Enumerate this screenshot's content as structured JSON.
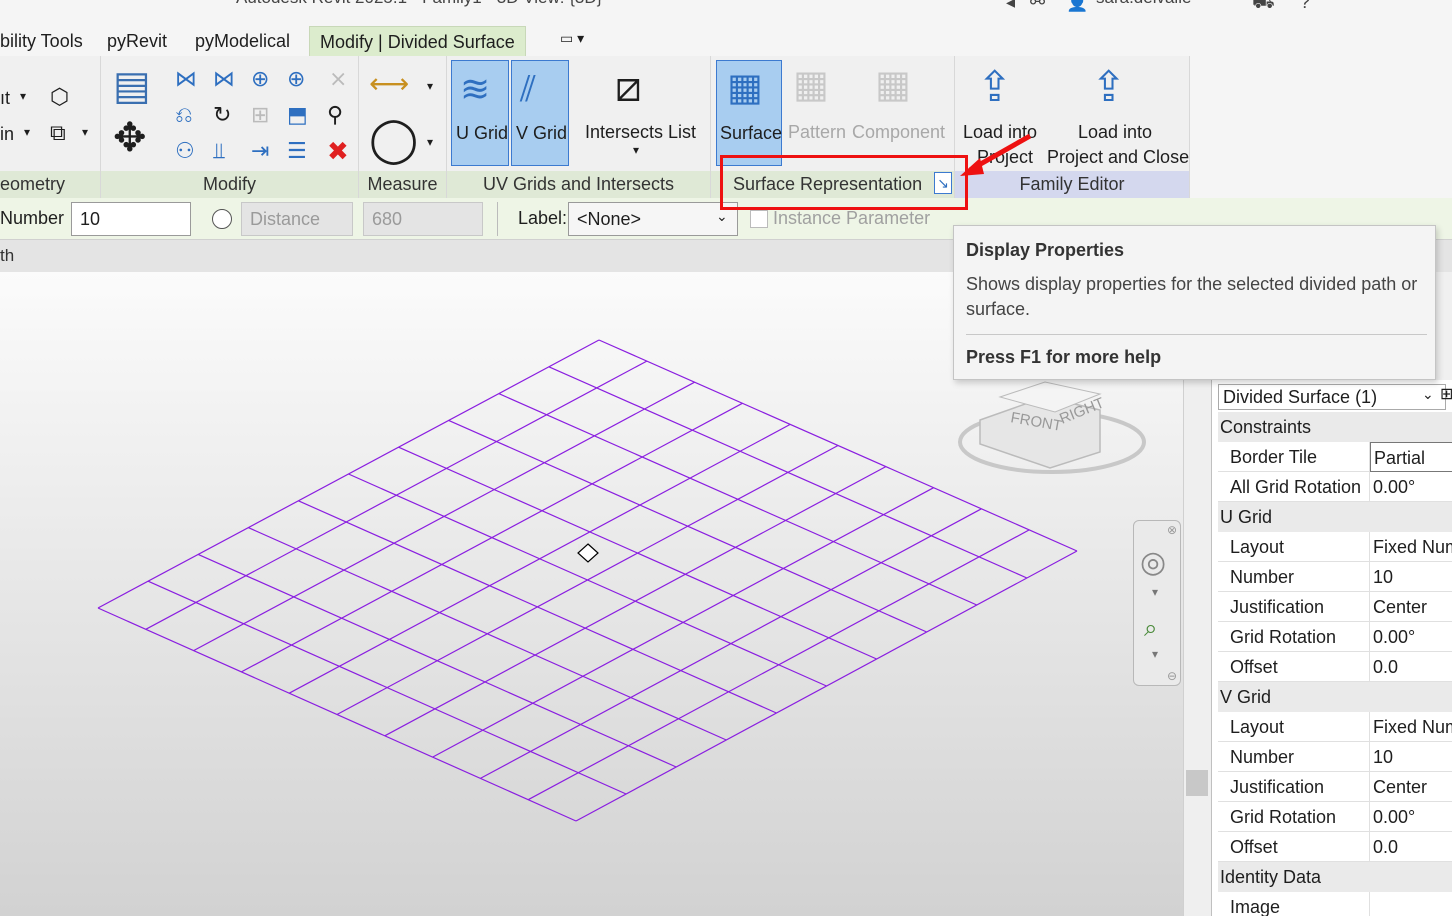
{
  "window": {
    "title": "Autodesk Revit 2025.1 - Family1 - 3D View: {3D}",
    "user": "sara.delvalle"
  },
  "tabs": [
    {
      "label": "bility Tools"
    },
    {
      "label": "pyRevit"
    },
    {
      "label": "pyModelical"
    },
    {
      "label": "Modify | Divided Surface"
    }
  ],
  "ribbon": {
    "geometry": {
      "label": "eometry",
      "items": [
        "ıt",
        "in"
      ]
    },
    "modify": {
      "label": "Modify"
    },
    "measure": {
      "label": "Measure"
    },
    "uvgrids": {
      "label": "UV Grids and Intersects",
      "u_grid": "U Grid",
      "v_grid": "V Grid",
      "intersects": "Intersects List"
    },
    "surface_rep": {
      "label": "Surface Representation",
      "surface": "Surface",
      "pattern": "Pattern",
      "component": "Component",
      "dialog_launcher": "↘"
    },
    "family_editor": {
      "label": "Family Editor",
      "load_into_project_1": "Load into",
      "load_into_project_2": "Project",
      "load_close_1": "Load into",
      "load_close_2": "Project and Close"
    }
  },
  "optionsbar": {
    "number_label": "Number",
    "number_value": "10",
    "distance_placeholder": "Distance",
    "distance_value": "680",
    "label_label": "Label:",
    "label_value": "<None>",
    "instance_param": "Instance Parameter"
  },
  "status_strip": "th",
  "tooltip": {
    "title": "Display Properties",
    "description": "Shows display properties for the selected divided path or surface.",
    "help": "Press F1 for more help"
  },
  "viewcube": {
    "front": "FRONT",
    "right": "RIGHT"
  },
  "properties": {
    "type_selector": "Divided Surface (1)",
    "rows": [
      {
        "group": "Constraints"
      },
      {
        "name": "Border Tile",
        "value": "Partial"
      },
      {
        "name": "All Grid Rotation",
        "value": "0.00°"
      },
      {
        "group": "U Grid"
      },
      {
        "name": "Layout",
        "value": "Fixed Num"
      },
      {
        "name": "Number",
        "value": "10"
      },
      {
        "name": "Justification",
        "value": "Center"
      },
      {
        "name": "Grid Rotation",
        "value": "0.00°"
      },
      {
        "name": "Offset",
        "value": "0.0"
      },
      {
        "group": "V Grid"
      },
      {
        "name": "Layout",
        "value": "Fixed Num"
      },
      {
        "name": "Number",
        "value": "10"
      },
      {
        "name": "Justification",
        "value": "Center"
      },
      {
        "name": "Grid Rotation",
        "value": "0.00°"
      },
      {
        "name": "Offset",
        "value": "0.0"
      },
      {
        "group": "Identity Data"
      },
      {
        "name": "Image",
        "value": ""
      }
    ]
  },
  "grid": {
    "u_divisions": 10,
    "v_divisions": 10,
    "line_color": "#8a1ee0"
  },
  "colors": {
    "accent_red": "#ee1111",
    "selected_blue": "#a8cdf0",
    "ribbon_green": "#dfe9d6"
  }
}
